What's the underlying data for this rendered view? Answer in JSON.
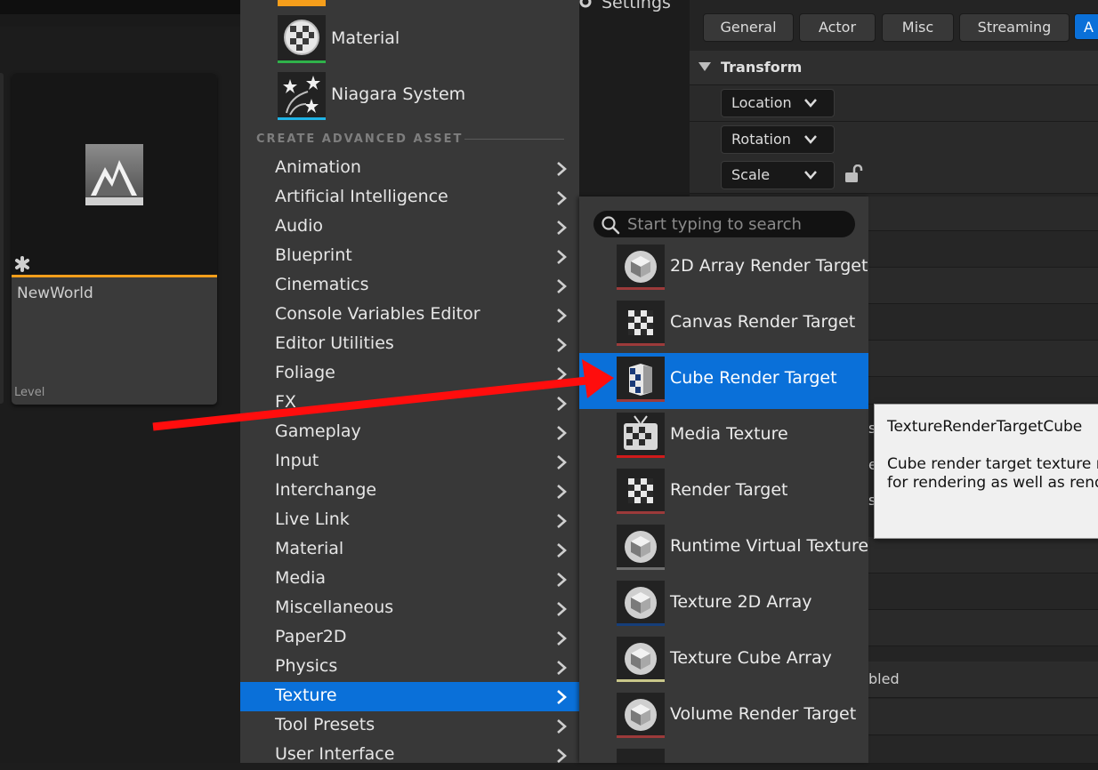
{
  "colors": {
    "accent": "#0a70d9",
    "asset_bar_level": "#f59e1b",
    "material_bar": "#2fb24a",
    "niagara_bar": "#1fb3e6",
    "render_target_bar": "#9c3a3a",
    "media_bar": "#d01a1a",
    "rvt_bar": "#6e6e6e",
    "array2d_bar": "#163e7a",
    "cube_array_bar": "#c9c78a",
    "arrow": "#ff0d0d"
  },
  "content_browser": {
    "asset": {
      "name": "NewWorld",
      "type": "Level",
      "icon": "level-icon"
    }
  },
  "menu": {
    "recent": [
      {
        "label": "Material",
        "icon": "material-icon"
      },
      {
        "label": "Niagara System",
        "icon": "niagara-icon"
      }
    ],
    "section_title": "CREATE ADVANCED ASSET",
    "items": [
      {
        "label": "Animation"
      },
      {
        "label": "Artificial Intelligence"
      },
      {
        "label": "Audio"
      },
      {
        "label": "Blueprint"
      },
      {
        "label": "Cinematics"
      },
      {
        "label": "Console Variables Editor"
      },
      {
        "label": "Editor Utilities"
      },
      {
        "label": "Foliage"
      },
      {
        "label": "FX"
      },
      {
        "label": "Gameplay"
      },
      {
        "label": "Input"
      },
      {
        "label": "Interchange"
      },
      {
        "label": "Live Link"
      },
      {
        "label": "Material"
      },
      {
        "label": "Media"
      },
      {
        "label": "Miscellaneous"
      },
      {
        "label": "Paper2D"
      },
      {
        "label": "Physics"
      },
      {
        "label": "Texture"
      },
      {
        "label": "Tool Presets"
      },
      {
        "label": "User Interface"
      }
    ],
    "selected": "Texture"
  },
  "submenu": {
    "search_placeholder": "Start typing to search",
    "items": [
      {
        "label": "2D Array Render Target",
        "icon": "render-target-2d-array-icon"
      },
      {
        "label": "Canvas Render Target",
        "icon": "canvas-render-target-icon"
      },
      {
        "label": "Cube Render Target",
        "icon": "cube-render-target-icon"
      },
      {
        "label": "Media Texture",
        "icon": "media-texture-icon"
      },
      {
        "label": "Render Target",
        "icon": "render-target-icon"
      },
      {
        "label": "Runtime Virtual Texture",
        "icon": "runtime-virtual-texture-icon"
      },
      {
        "label": "Texture 2D Array",
        "icon": "texture-2d-array-icon"
      },
      {
        "label": "Texture Cube Array",
        "icon": "texture-cube-array-icon"
      },
      {
        "label": "Volume Render Target",
        "icon": "volume-render-target-icon"
      }
    ],
    "selected": "Cube Render Target"
  },
  "tooltip": {
    "title": "TextureRenderTargetCube",
    "body": "Cube render target texture reso\nfor rendering as well as render"
  },
  "details": {
    "header_label": "Settings",
    "tabs": [
      {
        "label": "General"
      },
      {
        "label": "Actor"
      },
      {
        "label": "Misc"
      },
      {
        "label": "Streaming"
      },
      {
        "label": "A"
      }
    ],
    "section": "Transform",
    "properties": [
      {
        "label": "Location"
      },
      {
        "label": "Rotation"
      },
      {
        "label": "Scale"
      }
    ],
    "fragments": {
      "s1": "s",
      "e1": "e",
      "s2": "s",
      "bled": "bled"
    }
  }
}
